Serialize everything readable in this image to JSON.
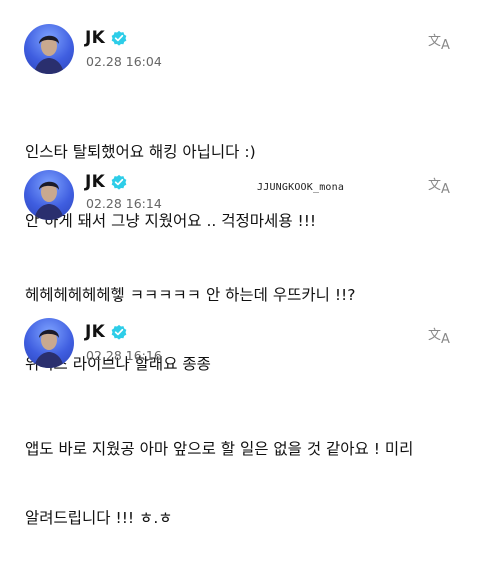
{
  "posts": [
    {
      "author": "JK",
      "timestamp": "02.28 16:04",
      "lines": [
        "인스타 탈퇴했어요 해킹 아닙니다 :)",
        "안 하게 돼서 그냥 지웠어요 .. 걱정마세용 !!!"
      ]
    },
    {
      "author": "JK",
      "timestamp": "02.28 16:14",
      "lines": [
        "헤헤헤헤헤헤헿 ㅋㅋㅋㅋㅋ 안 하는데 우뜨카니 !!?",
        "위버스 라이브나 할래요 종종"
      ]
    },
    {
      "author": "JK",
      "timestamp": "02.28 16:16",
      "lines": [
        "앱도 바로 지웠공 아마 앞으로 할 일은 없을 것 같아요 ! 미리",
        "알려드립니다 !!! ㅎ.ㅎ"
      ]
    }
  ],
  "watermark": "JJUNGKOOK_mona",
  "icons": {
    "verified": "verified-badge-icon",
    "translate": "translate-icon"
  },
  "colors": {
    "verified": "#2dcde8",
    "avatar": "#3f5ee0",
    "timestamp": "#666666"
  }
}
